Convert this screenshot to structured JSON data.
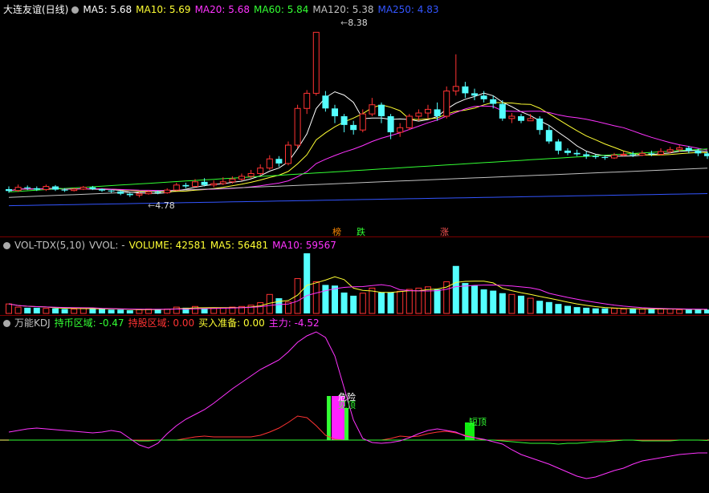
{
  "main_panel": {
    "title": "大连友谊(日线)",
    "indicators": [
      {
        "label": "MA5: 5.68",
        "color": "#ffffff"
      },
      {
        "label": "MA10: 5.69",
        "color": "#ffff33"
      },
      {
        "label": "MA20: 5.68",
        "color": "#ff33ff"
      },
      {
        "label": "MA60: 5.84",
        "color": "#33ff33"
      },
      {
        "label": "MA120: 5.38",
        "color": "#c0c0c0"
      },
      {
        "label": "MA250: 4.83",
        "color": "#3355ff"
      }
    ],
    "high_label": "8.38",
    "low_label": "4.78",
    "markers": [
      {
        "text": "榜",
        "color": "#ff8800"
      },
      {
        "text": "跌",
        "color": "#33ff33"
      },
      {
        "text": "涨",
        "color": "#ff5555"
      }
    ]
  },
  "vol_panel": {
    "title": "VOL-TDX(5,10)",
    "indicators": [
      {
        "label": "VVOL: -",
        "color": "#c0c0c0"
      },
      {
        "label": "VOLUME: 42581",
        "color": "#ffff33"
      },
      {
        "label": "MA5: 56481",
        "color": "#ffff33"
      },
      {
        "label": "MA10: 59567",
        "color": "#ff33ff"
      }
    ]
  },
  "kdj_panel": {
    "title": "万能KDJ",
    "indicators": [
      {
        "label": "持币区域: -0.47",
        "color": "#33ff33"
      },
      {
        "label": "持股区域: 0.00",
        "color": "#ff3333"
      },
      {
        "label": "买入准备: 0.00",
        "color": "#ffff33"
      },
      {
        "label": "主力: -4.52",
        "color": "#ff33ff"
      }
    ],
    "annotations": [
      {
        "text": "危险",
        "color": "#ffffff"
      },
      {
        "text": "见顶",
        "color": "#33ff33"
      },
      {
        "text": "短顶",
        "color": "#33ff33"
      }
    ]
  },
  "colors": {
    "up": "#ff3333",
    "down": "#54ffff",
    "background": "#000000"
  },
  "chart_data": [
    {
      "type": "candlestick",
      "title": "大连友谊(日线)",
      "candles": [
        [
          4.96,
          4.92,
          5.02,
          4.88
        ],
        [
          4.93,
          5.0,
          5.06,
          4.9
        ],
        [
          5.0,
          4.98,
          5.04,
          4.94
        ],
        [
          4.98,
          4.95,
          5.02,
          4.92
        ],
        [
          4.95,
          5.02,
          5.06,
          4.92
        ],
        [
          5.02,
          4.95,
          5.05,
          4.92
        ],
        [
          4.95,
          4.93,
          4.98,
          4.9
        ],
        [
          4.93,
          4.96,
          4.99,
          4.91
        ],
        [
          4.96,
          5.0,
          5.03,
          4.94
        ],
        [
          5.0,
          4.96,
          5.03,
          4.94
        ],
        [
          4.96,
          4.93,
          4.98,
          4.9
        ],
        [
          4.93,
          4.91,
          4.95,
          4.88
        ],
        [
          4.91,
          4.86,
          4.93,
          4.83
        ],
        [
          4.86,
          4.83,
          4.88,
          4.79
        ],
        [
          4.83,
          4.86,
          4.9,
          4.78
        ],
        [
          4.86,
          4.9,
          4.93,
          4.84
        ],
        [
          4.9,
          4.88,
          4.93,
          4.85
        ],
        [
          4.88,
          4.94,
          4.98,
          4.86
        ],
        [
          4.94,
          5.05,
          5.1,
          4.92
        ],
        [
          5.05,
          5.02,
          5.1,
          4.98
        ],
        [
          5.02,
          5.12,
          5.18,
          5.0
        ],
        [
          5.12,
          5.05,
          5.2,
          5.02
        ],
        [
          5.05,
          5.08,
          5.15,
          5.0
        ],
        [
          5.08,
          5.12,
          5.22,
          5.05
        ],
        [
          5.12,
          5.18,
          5.24,
          5.08
        ],
        [
          5.18,
          5.24,
          5.3,
          5.14
        ],
        [
          5.24,
          5.3,
          5.38,
          5.2
        ],
        [
          5.3,
          5.42,
          5.5,
          5.26
        ],
        [
          5.42,
          5.62,
          5.7,
          5.38
        ],
        [
          5.62,
          5.52,
          5.68,
          5.45
        ],
        [
          5.52,
          5.92,
          6.0,
          5.48
        ],
        [
          5.92,
          6.72,
          6.8,
          5.85
        ],
        [
          6.72,
          7.05,
          7.12,
          6.6
        ],
        [
          7.05,
          8.38,
          8.38,
          7.0
        ],
        [
          7.0,
          6.72,
          7.1,
          6.65
        ],
        [
          6.72,
          6.55,
          6.8,
          6.4
        ],
        [
          6.55,
          6.36,
          6.6,
          6.2
        ],
        [
          6.36,
          6.25,
          6.45,
          6.15
        ],
        [
          6.25,
          6.6,
          6.7,
          6.2
        ],
        [
          6.6,
          6.8,
          6.95,
          6.55
        ],
        [
          6.8,
          6.55,
          6.85,
          6.4
        ],
        [
          6.55,
          6.2,
          6.6,
          6.05
        ],
        [
          6.2,
          6.3,
          6.4,
          6.1
        ],
        [
          6.3,
          6.55,
          6.6,
          6.25
        ],
        [
          6.55,
          6.62,
          6.7,
          6.45
        ],
        [
          6.62,
          6.7,
          6.8,
          6.5
        ],
        [
          6.7,
          6.55,
          6.85,
          6.45
        ],
        [
          6.55,
          7.1,
          7.2,
          6.5
        ],
        [
          7.1,
          7.2,
          7.9,
          7.0
        ],
        [
          7.2,
          7.05,
          7.3,
          6.95
        ],
        [
          7.05,
          7.0,
          7.15,
          6.9
        ],
        [
          7.0,
          6.92,
          7.1,
          6.85
        ],
        [
          6.92,
          6.82,
          7.0,
          6.72
        ],
        [
          6.82,
          6.5,
          6.9,
          6.45
        ],
        [
          6.5,
          6.55,
          6.62,
          6.4
        ],
        [
          6.55,
          6.45,
          6.6,
          6.4
        ],
        [
          6.45,
          6.5,
          6.6,
          6.45
        ],
        [
          6.5,
          6.25,
          6.55,
          6.15
        ],
        [
          6.25,
          6.0,
          6.35,
          5.95
        ],
        [
          6.0,
          5.8,
          6.05,
          5.72
        ],
        [
          5.8,
          5.75,
          5.85,
          5.7
        ],
        [
          5.75,
          5.72,
          5.82,
          5.68
        ],
        [
          5.72,
          5.68,
          5.78,
          5.62
        ],
        [
          5.68,
          5.66,
          5.72,
          5.62
        ],
        [
          5.66,
          5.64,
          5.7,
          5.6
        ],
        [
          5.64,
          5.7,
          5.75,
          5.62
        ],
        [
          5.7,
          5.72,
          5.78,
          5.68
        ],
        [
          5.72,
          5.7,
          5.78,
          5.66
        ],
        [
          5.7,
          5.74,
          5.8,
          5.68
        ],
        [
          5.74,
          5.72,
          5.8,
          5.68
        ],
        [
          5.72,
          5.78,
          5.85,
          5.7
        ],
        [
          5.78,
          5.82,
          5.88,
          5.74
        ],
        [
          5.82,
          5.86,
          5.92,
          5.78
        ],
        [
          5.86,
          5.8,
          5.9,
          5.74
        ],
        [
          5.8,
          5.74,
          5.84,
          5.68
        ],
        [
          5.74,
          5.68,
          5.78,
          5.62
        ]
      ],
      "ylim": [
        4.4,
        8.7
      ]
    },
    {
      "type": "bar",
      "title": "VOL-TDX(5,10)",
      "values": [
        15,
        10,
        9,
        9,
        8,
        8,
        7,
        7,
        8,
        8,
        7,
        6,
        6,
        5,
        6,
        7,
        7,
        7,
        10,
        9,
        11,
        8,
        8,
        9,
        10,
        11,
        13,
        17,
        30,
        24,
        18,
        55,
        95,
        50,
        45,
        44,
        33,
        28,
        32,
        40,
        33,
        33,
        35,
        38,
        40,
        42,
        38,
        50,
        75,
        48,
        44,
        38,
        36,
        32,
        30,
        28,
        24,
        20,
        18,
        15,
        12,
        10,
        9,
        8,
        8,
        8,
        7,
        7,
        7,
        7,
        7,
        7,
        6,
        6,
        6,
        6
      ],
      "up": [
        1,
        1,
        0,
        0,
        1,
        0,
        0,
        1,
        1,
        0,
        0,
        0,
        0,
        0,
        1,
        1,
        0,
        1,
        1,
        0,
        1,
        0,
        1,
        1,
        1,
        1,
        1,
        1,
        1,
        0,
        1,
        1,
        0,
        1,
        0,
        0,
        0,
        0,
        1,
        1,
        0,
        0,
        1,
        1,
        1,
        1,
        0,
        1,
        0,
        0,
        0,
        0,
        0,
        0,
        1,
        0,
        1,
        0,
        0,
        0,
        0,
        0,
        0,
        0,
        0,
        1,
        1,
        0,
        1,
        0,
        1,
        1,
        1,
        0,
        0,
        0
      ]
    },
    {
      "type": "line",
      "title": "万能KDJ",
      "series": [
        {
          "name": "主力",
          "values": [
            10,
            12,
            14,
            15,
            14,
            13,
            12,
            11,
            10,
            9,
            10,
            12,
            10,
            2,
            -6,
            -10,
            -4,
            8,
            18,
            26,
            32,
            38,
            46,
            55,
            64,
            72,
            80,
            88,
            94,
            100,
            110,
            122,
            130,
            135,
            128,
            105,
            65,
            25,
            2,
            -3,
            -4,
            -3,
            -1,
            3,
            8,
            12,
            14,
            12,
            10,
            5,
            3,
            1,
            -2,
            -5,
            -12,
            -18,
            -22,
            -26,
            -30,
            -35,
            -40,
            -45,
            -48,
            -46,
            -42,
            -38,
            -35,
            -30,
            -26,
            -24,
            -22,
            -20,
            -18,
            -17,
            -16,
            -16
          ]
        },
        {
          "name": "持币区域",
          "values": [
            0,
            0,
            0,
            0,
            0,
            0,
            0,
            0,
            0,
            0,
            0,
            0,
            0,
            0,
            -1,
            -1,
            0,
            0,
            0,
            0,
            0,
            0,
            0,
            0,
            0,
            0,
            0,
            0,
            0,
            0,
            0,
            0,
            0,
            0,
            0,
            0,
            0,
            0,
            0,
            0,
            0,
            0,
            0,
            0,
            0,
            0,
            0,
            0,
            0,
            0,
            0,
            0,
            0,
            -1,
            -2,
            -3,
            -4,
            -4,
            -4,
            -5,
            -4,
            -4,
            -3,
            -2,
            -2,
            -1,
            0,
            0,
            -1,
            -1,
            -1,
            -1,
            0,
            0,
            0,
            -0.47
          ]
        },
        {
          "name": "持股区域",
          "values": [
            0,
            0,
            0,
            0,
            0,
            0,
            0,
            0,
            0,
            0,
            0,
            0,
            0,
            0,
            0,
            0,
            0,
            0,
            0,
            2,
            4,
            5,
            4,
            4,
            4,
            4,
            4,
            6,
            10,
            15,
            22,
            30,
            28,
            18,
            6,
            1,
            0,
            0,
            0,
            0,
            0,
            2,
            5,
            4,
            5,
            8,
            10,
            11,
            9,
            6,
            3,
            0,
            0,
            0,
            0,
            0,
            0,
            0,
            0,
            0,
            0,
            0,
            0,
            0,
            0,
            0,
            0,
            0,
            0,
            0,
            0,
            0,
            0,
            0,
            0,
            0
          ]
        }
      ]
    }
  ]
}
